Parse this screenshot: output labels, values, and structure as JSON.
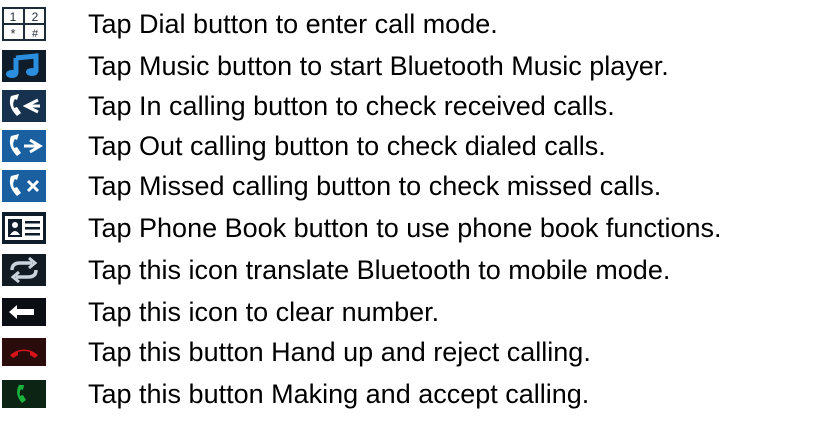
{
  "items": [
    {
      "icon": "keypad-icon",
      "text": "Tap Dial button to enter call mode."
    },
    {
      "icon": "music-note-icon",
      "text": "Tap Music button to start Bluetooth Music player."
    },
    {
      "icon": "incoming-call-icon",
      "text": "Tap In calling button to check received calls."
    },
    {
      "icon": "outgoing-call-icon",
      "text": "Tap Out calling button to check dialed calls."
    },
    {
      "icon": "missed-call-icon",
      "text": "Tap Missed calling button to check missed calls."
    },
    {
      "icon": "phone-book-icon",
      "text": "Tap Phone Book button to use phone book functions."
    },
    {
      "icon": "switch-mode-icon",
      "text": "Tap this icon translate Bluetooth to mobile mode."
    },
    {
      "icon": "backspace-arrow-icon",
      "text": "Tap this icon to clear number."
    },
    {
      "icon": "hang-up-icon",
      "text": "Tap this button Hand up and reject calling."
    },
    {
      "icon": "accept-call-icon",
      "text": "Tap this button Making and accept calling."
    }
  ],
  "keypad_keys": [
    "1",
    "2",
    "*",
    "#"
  ],
  "colors": {
    "icon_blue": "#1a73c8",
    "icon_dark": "#0f1d2b",
    "hangup_red": "#d8141a",
    "accept_green": "#19b43c"
  }
}
